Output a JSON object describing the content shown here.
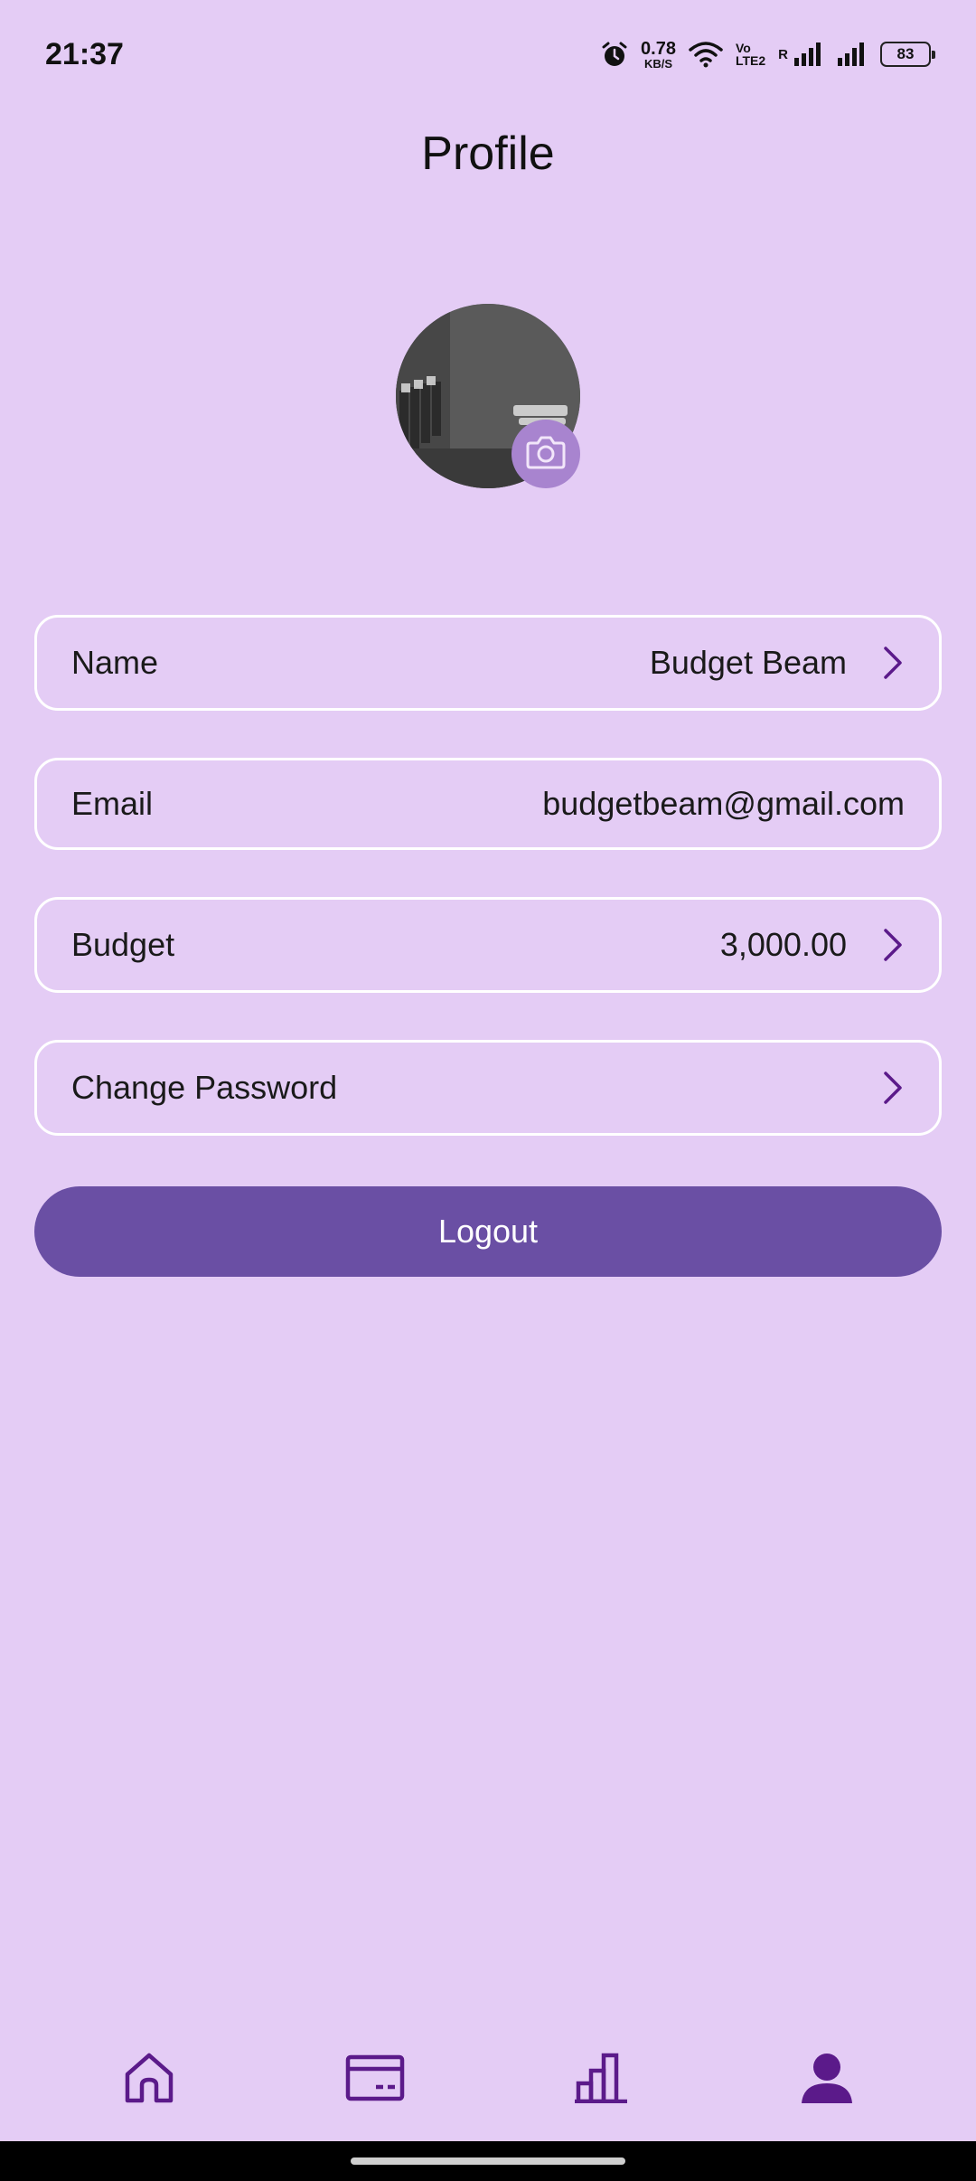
{
  "status_bar": {
    "time": "21:37",
    "net_speed_value": "0.78",
    "net_speed_unit": "KB/S",
    "volte_top": "Vo",
    "volte_bottom": "LTE2",
    "roaming": "R",
    "battery": "83"
  },
  "page": {
    "title": "Profile"
  },
  "avatar": {
    "camera_icon": "camera-icon"
  },
  "rows": {
    "name": {
      "label": "Name",
      "value": "Budget Beam"
    },
    "email": {
      "label": "Email",
      "value": "budgetbeam@gmail.com"
    },
    "budget": {
      "label": "Budget",
      "value": "3,000.00"
    },
    "password": {
      "label": "Change Password"
    }
  },
  "logout": {
    "label": "Logout"
  },
  "bottom_nav": {
    "items": [
      {
        "icon": "home-icon",
        "active": false
      },
      {
        "icon": "card-icon",
        "active": false
      },
      {
        "icon": "chart-icon",
        "active": false
      },
      {
        "icon": "profile-icon",
        "active": true
      }
    ]
  },
  "colors": {
    "background": "#E4CCF5",
    "accent": "#6A4FA4",
    "icon": "#5B1A8A",
    "camera_badge": "#A884CF"
  }
}
